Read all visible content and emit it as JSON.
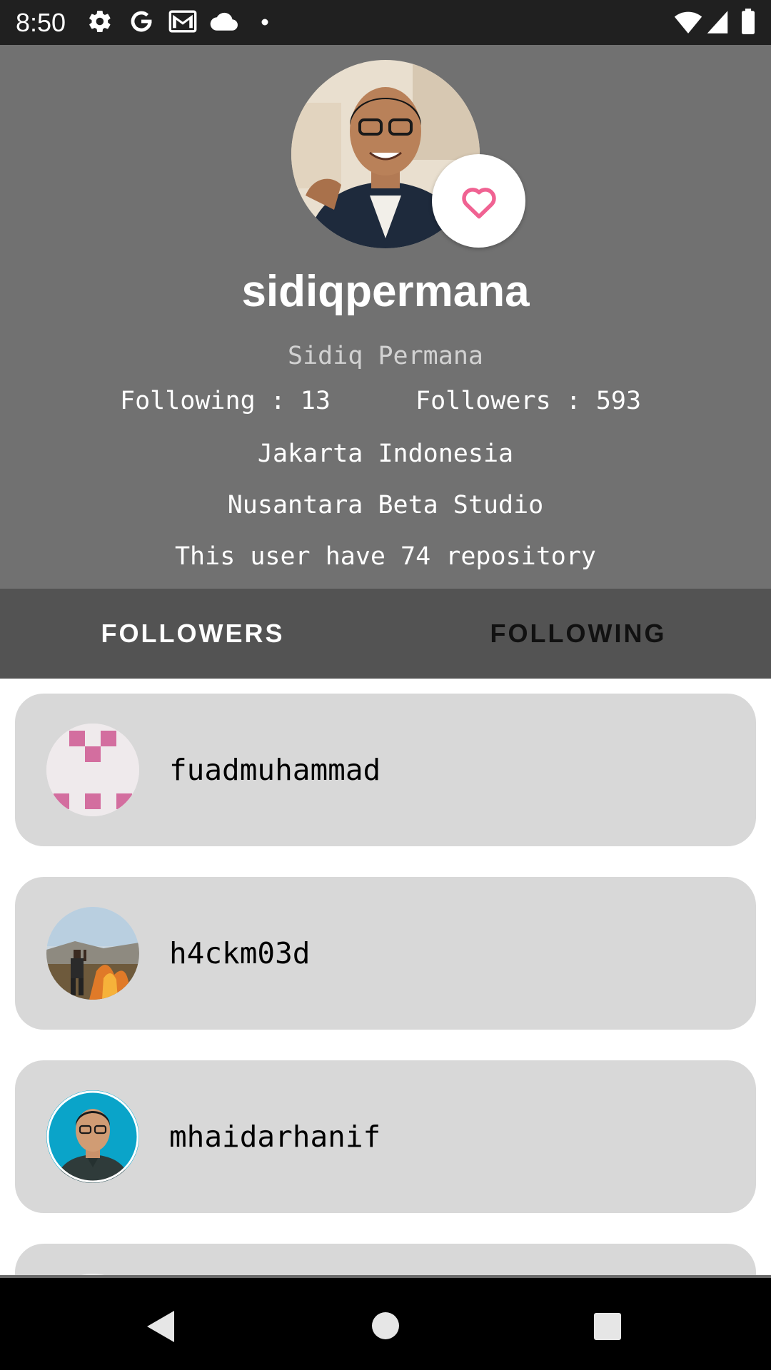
{
  "status_bar": {
    "time": "8:50",
    "left_icons": [
      "gear-icon",
      "google-icon",
      "gmail-icon",
      "cloud-icon",
      "dot-icon"
    ],
    "right_icons": [
      "wifi-icon",
      "signal-icon",
      "battery-icon"
    ]
  },
  "profile": {
    "username": "sidiqpermana",
    "full_name": "Sidiq Permana",
    "following_text": "Following : 13",
    "followers_text": "Followers : 593",
    "location": "Jakarta Indonesia",
    "company": "Nusantara Beta Studio",
    "repositories_text": "This user have 74 repository",
    "favorite_icon": "heart-outline-icon",
    "accent_color": "#f06292"
  },
  "tabs": [
    {
      "label": "FOLLOWERS",
      "selected": true
    },
    {
      "label": "FOLLOWING",
      "selected": false
    }
  ],
  "followers": [
    {
      "username": "fuadmuhammad",
      "avatar": "identicon-avatar"
    },
    {
      "username": "h4ckm03d",
      "avatar": "photo-avatar"
    },
    {
      "username": "mhaidarhanif",
      "avatar": "photo-avatar"
    },
    {
      "username": "",
      "avatar": "photo-avatar"
    }
  ],
  "nav_bar": {
    "buttons": [
      "back-icon",
      "home-icon",
      "recents-icon"
    ]
  }
}
